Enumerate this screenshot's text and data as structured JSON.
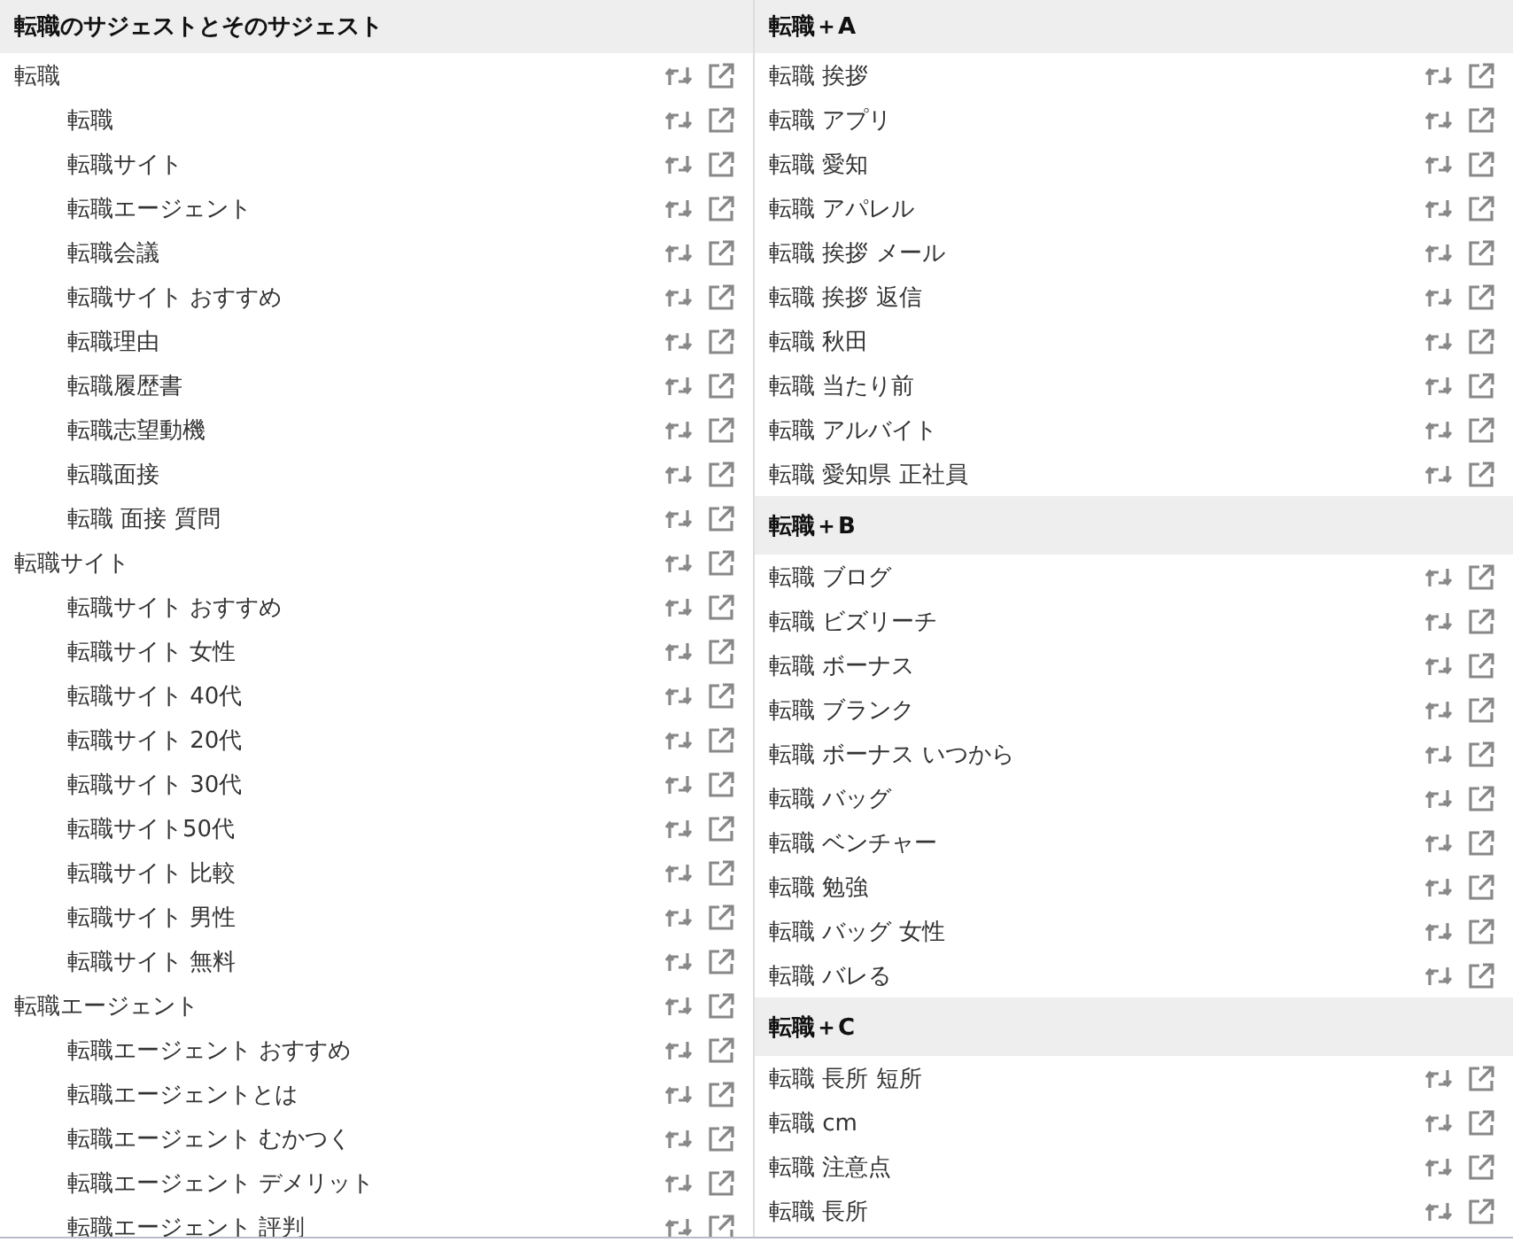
{
  "left": {
    "title": "転職のサジェストとそのサジェスト",
    "items": [
      {
        "label": "転職",
        "children": [
          {
            "label": "転職"
          },
          {
            "label": "転職サイト"
          },
          {
            "label": "転職エージェント"
          },
          {
            "label": "転職会議"
          },
          {
            "label": "転職サイト おすすめ"
          },
          {
            "label": "転職理由"
          },
          {
            "label": "転職履歴書"
          },
          {
            "label": "転職志望動機"
          },
          {
            "label": "転職面接"
          },
          {
            "label": "転職 面接 質問"
          }
        ]
      },
      {
        "label": "転職サイト",
        "children": [
          {
            "label": "転職サイト おすすめ"
          },
          {
            "label": "転職サイト 女性"
          },
          {
            "label": "転職サイト 40代"
          },
          {
            "label": "転職サイト 20代"
          },
          {
            "label": "転職サイト 30代"
          },
          {
            "label": "転職サイト50代"
          },
          {
            "label": "転職サイト 比較"
          },
          {
            "label": "転職サイト 男性"
          },
          {
            "label": "転職サイト 無料"
          }
        ]
      },
      {
        "label": "転職エージェント",
        "children": [
          {
            "label": "転職エージェント おすすめ"
          },
          {
            "label": "転職エージェントとは"
          },
          {
            "label": "転職エージェント むかつく"
          },
          {
            "label": "転職エージェント デメリット"
          },
          {
            "label": "転職エージェント 評判"
          }
        ]
      }
    ]
  },
  "right": {
    "sections": [
      {
        "title": "転職＋A",
        "items": [
          {
            "label": "転職 挨拶"
          },
          {
            "label": "転職 アプリ"
          },
          {
            "label": "転職 愛知"
          },
          {
            "label": "転職 アパレル"
          },
          {
            "label": "転職 挨拶 メール"
          },
          {
            "label": "転職 挨拶 返信"
          },
          {
            "label": "転職 秋田"
          },
          {
            "label": "転職 当たり前"
          },
          {
            "label": "転職 アルバイト"
          },
          {
            "label": "転職 愛知県 正社員"
          }
        ]
      },
      {
        "title": "転職＋B",
        "items": [
          {
            "label": "転職 ブログ"
          },
          {
            "label": "転職 ビズリーチ"
          },
          {
            "label": "転職 ボーナス"
          },
          {
            "label": "転職 ブランク"
          },
          {
            "label": "転職 ボーナス いつから"
          },
          {
            "label": "転職 バッグ"
          },
          {
            "label": "転職 ベンチャー"
          },
          {
            "label": "転職 勉強"
          },
          {
            "label": "転職 バッグ 女性"
          },
          {
            "label": "転職 バレる"
          }
        ]
      },
      {
        "title": "転職＋C",
        "items": [
          {
            "label": "転職 長所 短所"
          },
          {
            "label": "転職 cm"
          },
          {
            "label": "転職 注意点"
          },
          {
            "label": "転職 長所"
          }
        ]
      }
    ]
  }
}
